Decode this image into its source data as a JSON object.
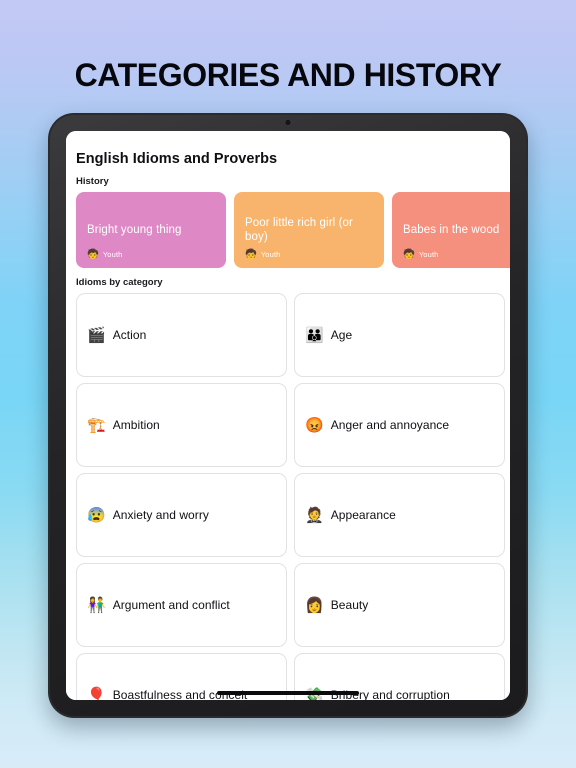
{
  "page": {
    "title": "CATEGORIES AND HISTORY"
  },
  "device": {
    "type": "tablet",
    "bezel_color": "#2b2b2d",
    "camera_icon": "camera-dot"
  },
  "app": {
    "title": "English Idioms and Proverbs",
    "history_section": {
      "label": "History",
      "cards": [
        {
          "title": "Bright young thing",
          "tag_label": "Youth",
          "tag_emoji": "🧒",
          "color": "#df88c6"
        },
        {
          "title": "Poor little rich girl (or boy)",
          "tag_label": "Youth",
          "tag_emoji": "🧒",
          "color": "#f8b46c"
        },
        {
          "title": "Babes in the wood",
          "tag_label": "Youth",
          "tag_emoji": "🧒",
          "color": "#f5907f"
        }
      ]
    },
    "category_section": {
      "label": "Idioms by category",
      "items": [
        {
          "label": "Action",
          "emoji": "🎬"
        },
        {
          "label": "Age",
          "emoji": "👪"
        },
        {
          "label": "Ambition",
          "emoji": "🏗️"
        },
        {
          "label": "Anger and annoyance",
          "emoji": "😡"
        },
        {
          "label": "Anxiety and worry",
          "emoji": "😰"
        },
        {
          "label": "Appearance",
          "emoji": "🤵"
        },
        {
          "label": "Argument and conflict",
          "emoji": "👫"
        },
        {
          "label": "Beauty",
          "emoji": "👩"
        },
        {
          "label": "Boastfulness and conceit",
          "emoji": "🎈"
        },
        {
          "label": "Bribery and corruption",
          "emoji": "💸"
        }
      ]
    }
  },
  "colors": {
    "background_top": "#c3c9f5",
    "background_mid": "#7ed3f7",
    "background_bottom": "#d8ecf8",
    "card_border": "#e2e2e5",
    "text_primary": "#101015"
  }
}
